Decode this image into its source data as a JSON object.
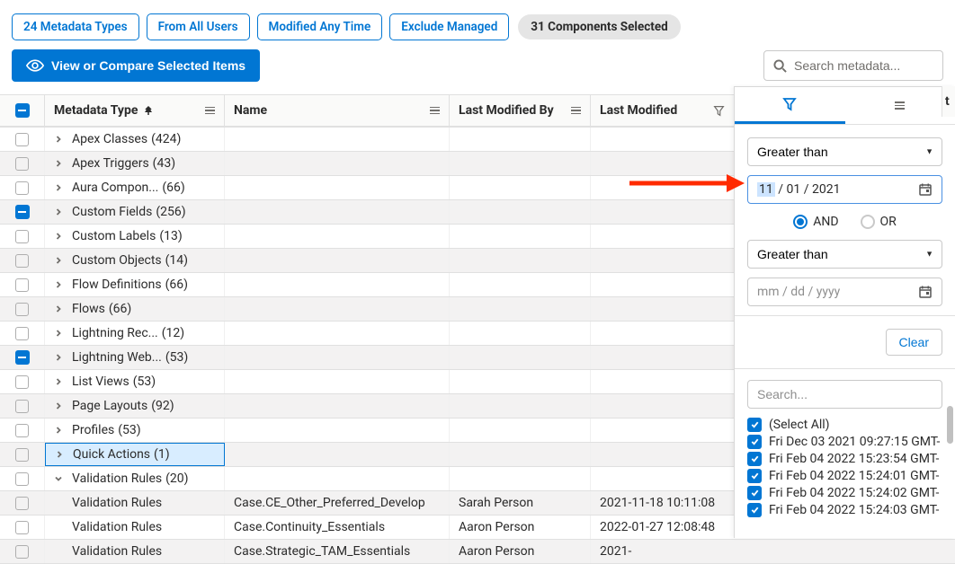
{
  "filters": {
    "types": "24 Metadata Types",
    "users": "From All Users",
    "time": "Modified Any Time",
    "managed": "Exclude Managed",
    "selected": "31 Components Selected"
  },
  "actions": {
    "view_compare": "View or Compare Selected Items"
  },
  "search": {
    "placeholder": "Search metadata..."
  },
  "columns": {
    "type": "Metadata Type",
    "name": "Name",
    "modified_by": "Last Modified By",
    "modified": "Last Modified"
  },
  "rows": [
    {
      "check": "empty",
      "caret": "right",
      "label": "Apex Classes",
      "count": "(424)",
      "grey": false
    },
    {
      "check": "empty",
      "caret": "right",
      "label": "Apex Triggers",
      "count": "(43)",
      "grey": true
    },
    {
      "check": "empty",
      "caret": "right",
      "label": "Aura Compon...",
      "count": "(66)",
      "grey": false
    },
    {
      "check": "minus",
      "caret": "right",
      "label": "Custom Fields",
      "count": "(256)",
      "grey": true
    },
    {
      "check": "empty",
      "caret": "right",
      "label": "Custom Labels",
      "count": "(13)",
      "grey": false
    },
    {
      "check": "empty",
      "caret": "right",
      "label": "Custom Objects",
      "count": "(14)",
      "grey": true
    },
    {
      "check": "empty",
      "caret": "right",
      "label": "Flow Definitions",
      "count": "(66)",
      "grey": false
    },
    {
      "check": "empty",
      "caret": "right",
      "label": "Flows",
      "count": "(66)",
      "grey": true
    },
    {
      "check": "empty",
      "caret": "right",
      "label": "Lightning Rec...",
      "count": "(12)",
      "grey": false
    },
    {
      "check": "minus",
      "caret": "right",
      "label": "Lightning Web...",
      "count": "(53)",
      "grey": true
    },
    {
      "check": "empty",
      "caret": "right",
      "label": "List Views",
      "count": "(53)",
      "grey": false
    },
    {
      "check": "empty",
      "caret": "right",
      "label": "Page Layouts",
      "count": "(92)",
      "grey": true
    },
    {
      "check": "empty",
      "caret": "right",
      "label": "Profiles",
      "count": "(53)",
      "grey": false
    },
    {
      "check": "empty",
      "caret": "right",
      "label": "Quick Actions",
      "count": "(1)",
      "grey": true,
      "selected": true
    },
    {
      "check": "empty",
      "caret": "down",
      "label": "Validation Rules",
      "count": "(20)",
      "grey": false
    },
    {
      "check": "empty",
      "indent": true,
      "label": "Validation Rules",
      "name": "Case.CE_Other_Preferred_Develop",
      "modby": "Sarah Person",
      "mod": "2021-11-18 10:11:08",
      "grey": true
    },
    {
      "check": "empty",
      "indent": true,
      "label": "Validation Rules",
      "name": "Case.Continuity_Essentials",
      "modby": "Aaron Person",
      "mod": "2022-01-27 12:08:48",
      "grey": false
    },
    {
      "check": "empty",
      "indent": true,
      "label": "Validation Rules",
      "name": "Case.Strategic_TAM_Essentials",
      "modby": "Aaron Person",
      "mod": "2021-",
      "grey": true
    }
  ],
  "panel": {
    "op1": "Greater than",
    "date1": {
      "mm": "11",
      "dd": "01",
      "yyyy": "2021"
    },
    "logic_and": "AND",
    "logic_or": "OR",
    "op2": "Greater than",
    "date2_placeholder": "mm / dd / yyyy",
    "clear": "Clear",
    "search_placeholder": "Search...",
    "select_all": "(Select All)",
    "items": [
      "Fri Dec 03 2021 09:27:15 GMT-",
      "Fri Feb 04 2022 15:23:54 GMT-",
      "Fri Feb 04 2022 15:24:01 GMT-",
      "Fri Feb 04 2022 15:24:02 GMT-",
      "Fri Feb 04 2022 15:24:03 GMT-"
    ]
  },
  "truncated_col": "t"
}
